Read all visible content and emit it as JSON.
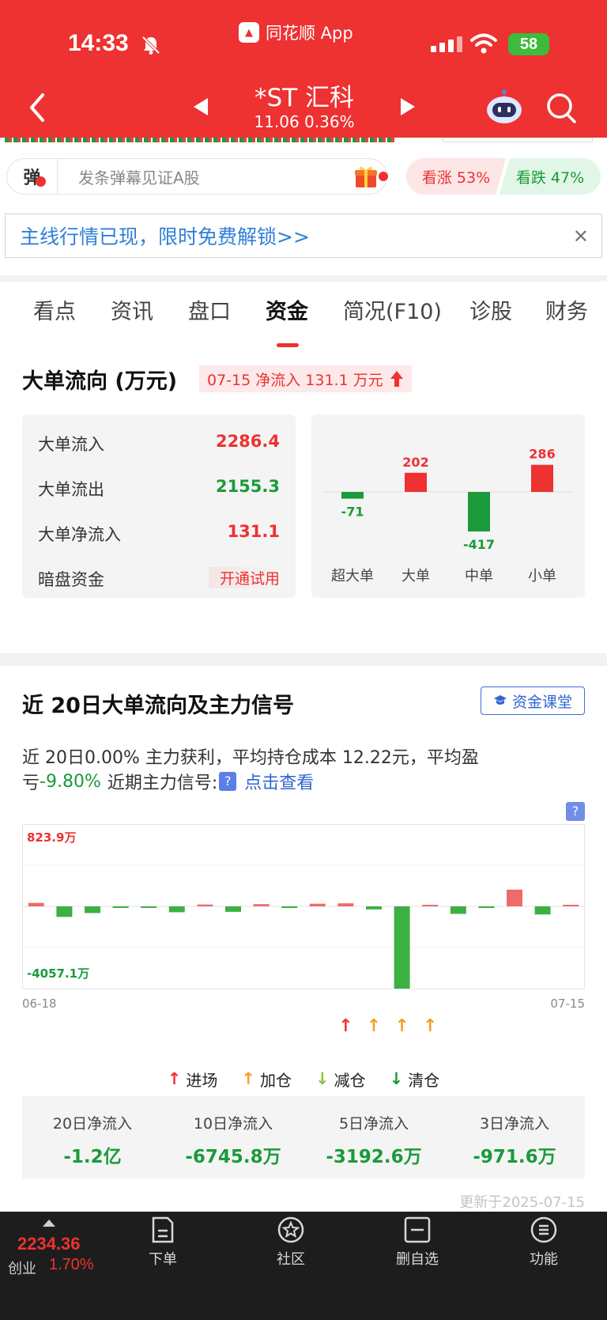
{
  "status_bar": {
    "time": "14:33",
    "app_name": "同花顺 App",
    "battery": "58"
  },
  "nav": {
    "stock_name": "*ST 汇科",
    "stock_price": "11.06 0.36%"
  },
  "danmu": {
    "badge": "弹",
    "placeholder": "发条弹幕见证A股"
  },
  "vote": {
    "up": "看涨 53%",
    "down": "看跌 47%"
  },
  "promo": {
    "text": "主线行情已现，限时免费解锁>>"
  },
  "tabs": [
    "看点",
    "资讯",
    "盘口",
    "资金",
    "简况(F10)",
    "诊股",
    "财务"
  ],
  "big_order": {
    "title": "大单流向 (万元)",
    "net_badge": "07-15 净流入 131.1 万元",
    "rows": [
      {
        "label": "大单流入",
        "value": "2286.4"
      },
      {
        "label": "大单流出",
        "value": "2155.3"
      },
      {
        "label": "大单净流入",
        "value": "131.1"
      },
      {
        "label": "暗盘资金",
        "value": "开通试用"
      }
    ]
  },
  "signal": {
    "title": "近 20日大单流向及主力信号",
    "course_button": "资金课堂",
    "text1": "近 20日0.00% 主力获利，平均持仓成本 12.22元，平均盈",
    "text2_prefix": "亏",
    "text2_value": "-9.80%",
    "text2_suffix": "近期主力信号:",
    "view_link": "点击查看",
    "legend": {
      "enter": "进场",
      "add": "加仓",
      "reduce": "减仓",
      "clear": "清仓"
    },
    "totals": [
      {
        "label": "20日净流入",
        "value": "-1.2亿"
      },
      {
        "label": "10日净流入",
        "value": "-6745.8万"
      },
      {
        "label": "5日净流入",
        "value": "-3192.6万"
      },
      {
        "label": "3日净流入",
        "value": "-971.6万"
      }
    ],
    "updated": "更新于2025-07-15"
  },
  "bottom": {
    "index_value": "2234.36",
    "index_name": "创业",
    "index_pct": "1.70%",
    "items": [
      "下单",
      "社区",
      "删自选",
      "功能"
    ]
  },
  "colors": {
    "header_red": "#ee3131",
    "rise_red": "#ee3131",
    "fall_green": "#1a9a3a",
    "link_blue": "#2f66d0"
  },
  "chart_data": [
    {
      "type": "bar",
      "categories": [
        "超大单",
        "大单",
        "中单",
        "小单"
      ],
      "values": [
        -71,
        202,
        -417,
        286
      ]
    },
    {
      "type": "bar",
      "x_range_labels": [
        "06-18",
        "07-15"
      ],
      "max_label": "823.9万",
      "min_label": "-4057.1万",
      "values": [
        170,
        -520,
        -330,
        -30,
        -40,
        -290,
        90,
        -270,
        110,
        -80,
        130,
        150,
        -150,
        -4057.1,
        12,
        -370,
        -80,
        823.9,
        -400,
        30
      ],
      "signals": [
        {
          "index": 11,
          "type": "enter"
        },
        {
          "index": 12,
          "type": "add"
        },
        {
          "index": 13,
          "type": "add"
        },
        {
          "index": 14,
          "type": "add"
        }
      ]
    }
  ]
}
